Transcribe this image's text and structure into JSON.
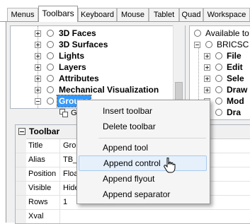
{
  "tabs": [
    "Menus",
    "Toolbars",
    "Keyboard",
    "Mouse",
    "Tablet",
    "Quad",
    "Workspace"
  ],
  "active_tab": "Toolbars",
  "tree_left": {
    "items": [
      {
        "label": "3D Faces"
      },
      {
        "label": "3D Surfaces"
      },
      {
        "label": "Lights"
      },
      {
        "label": "Layers"
      },
      {
        "label": "Attributes"
      },
      {
        "label": "Mechanical Visualization"
      },
      {
        "label": "Groups"
      },
      {
        "label": "G"
      }
    ]
  },
  "tree_right": {
    "items": [
      {
        "label": "Available to"
      },
      {
        "label": "BRICSC"
      },
      {
        "label": "File"
      },
      {
        "label": "Edit"
      },
      {
        "label": "Sele"
      },
      {
        "label": "Draw"
      },
      {
        "label": "Mod"
      },
      {
        "label": "Dra"
      }
    ]
  },
  "properties": {
    "header": "Toolbar",
    "rows": [
      {
        "name": "Title",
        "value": "Grou"
      },
      {
        "name": "Alias",
        "value": "TB_G"
      },
      {
        "name": "Position",
        "value": "Floati"
      },
      {
        "name": "Visible",
        "value": "Hide"
      },
      {
        "name": "Rows",
        "value": "1"
      },
      {
        "name": "Xval",
        "value": ""
      }
    ]
  },
  "context_menu": {
    "items": [
      {
        "label": "Insert toolbar"
      },
      {
        "label": "Delete toolbar"
      },
      {
        "label": "Append tool"
      },
      {
        "label": "Append control"
      },
      {
        "label": "Append flyout"
      },
      {
        "label": "Append separator"
      }
    ],
    "highlighted": "Append control"
  }
}
